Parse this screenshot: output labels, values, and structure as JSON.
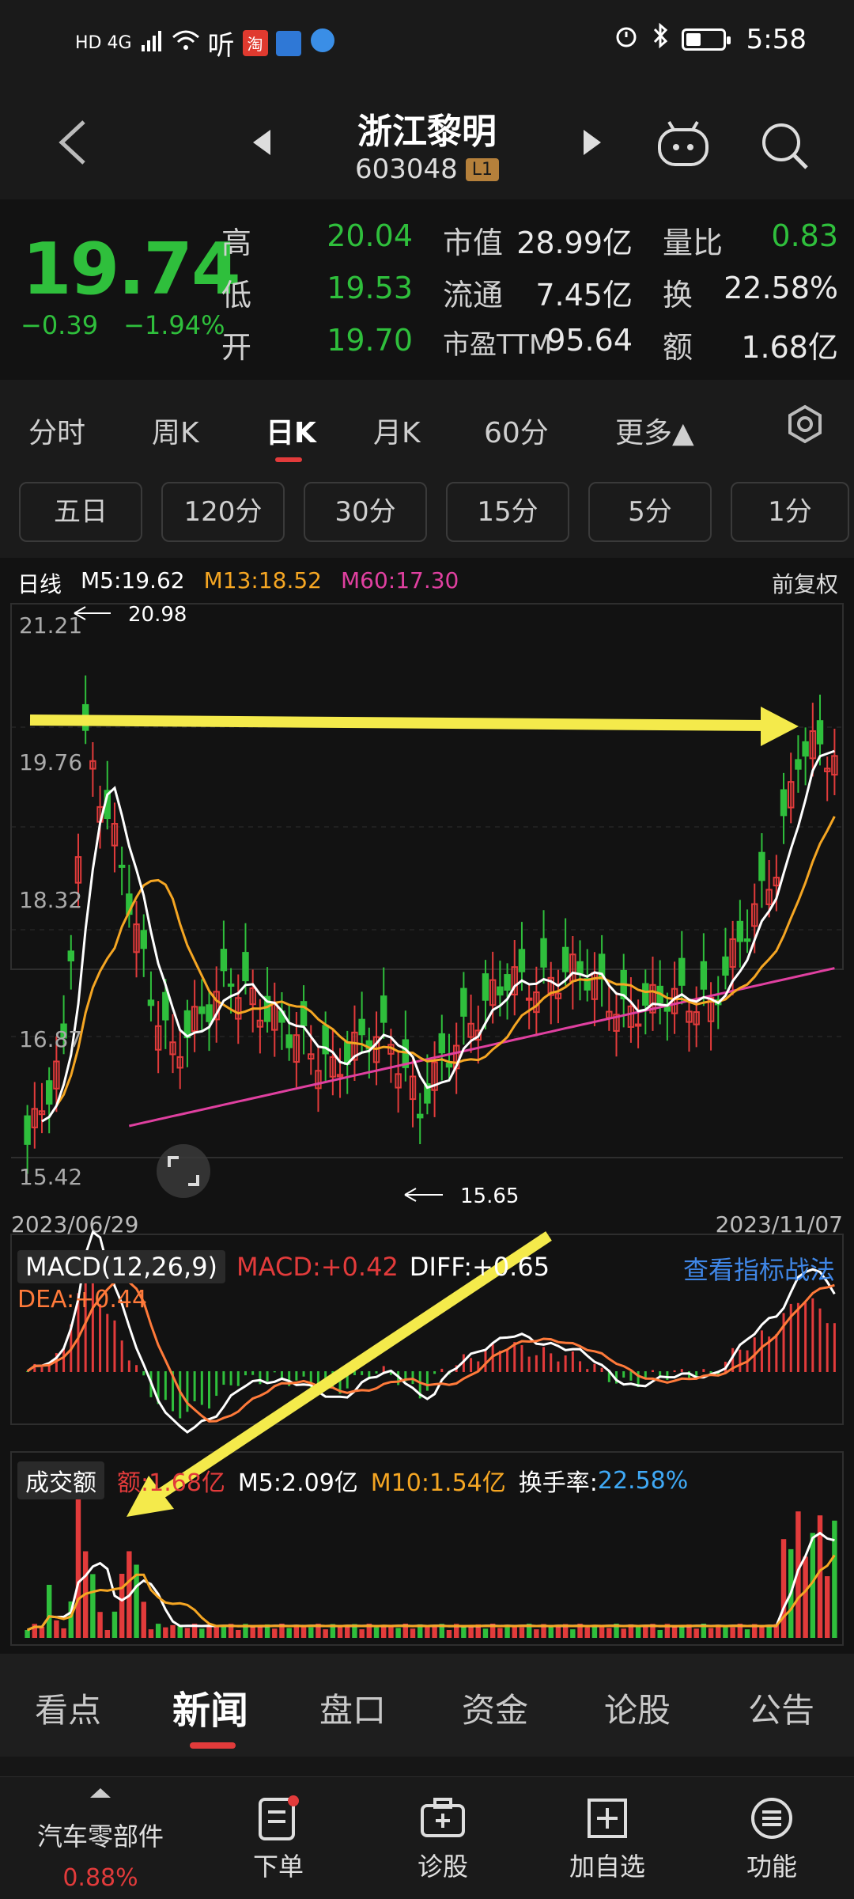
{
  "status_bar": {
    "left_text": "HD 4G",
    "app_badge1": "淘",
    "time": "5:58"
  },
  "header": {
    "title": "浙江黎明",
    "code": "603048",
    "level": "L1"
  },
  "quote": {
    "price": "19.74",
    "change": "−0.39",
    "change_pct": "−1.94%",
    "high_label": "高",
    "high": "20.04",
    "low_label": "低",
    "low": "19.53",
    "open_label": "开",
    "open": "19.70",
    "mcap_label": "市值",
    "mcap": "28.99亿",
    "float_label": "流通",
    "float": "7.45亿",
    "pe_label": "市盈TTM",
    "pe": "95.64",
    "volratio_label": "量比",
    "volratio": "0.83",
    "turnover_label": "换",
    "turnover": "22.58%",
    "amount_label": "额",
    "amount": "1.68亿"
  },
  "tabs": [
    "分时",
    "周K",
    "日K",
    "月K",
    "60分",
    "更多▲"
  ],
  "subtabs": [
    "五日",
    "120分",
    "30分",
    "15分",
    "5分",
    "1分"
  ],
  "kline": {
    "legend_title": "日线",
    "m5": "M5:19.62",
    "m13": "M13:18.52",
    "m60": "M60:17.30",
    "fuquan": "前复权",
    "y_ticks": [
      "21.21",
      "19.76",
      "18.32",
      "16.87",
      "15.42"
    ],
    "max_label": "20.98",
    "min_label": "15.65",
    "date_start": "2023/06/29",
    "date_end": "2023/11/07"
  },
  "macd": {
    "selector": "MACD(12,26,9)",
    "macd": "MACD:+0.42",
    "dif": "DIFF:+0.65",
    "dea": "DEA:+0.44",
    "link": "查看指标战法"
  },
  "volume": {
    "selector": "成交额",
    "amount": "额:1.68亿",
    "m5": "M5:2.09亿",
    "m10": "M10:1.54亿",
    "turnover_label": "换手率:",
    "turnover": "22.58%"
  },
  "news_tabs": [
    "看点",
    "新闻",
    "盘口",
    "资金",
    "论股",
    "公告"
  ],
  "bottom_nav": {
    "sector_name": "汽车零部件",
    "sector_pct": "0.88%",
    "items": [
      "下单",
      "诊股",
      "加自选",
      "功能"
    ]
  },
  "colors": {
    "up": "#e23b3b",
    "down": "#2fbf3c",
    "m5": "#ffffff",
    "m13": "#f5a623",
    "m60": "#e040a0",
    "arrow": "#f4ea4b"
  }
}
